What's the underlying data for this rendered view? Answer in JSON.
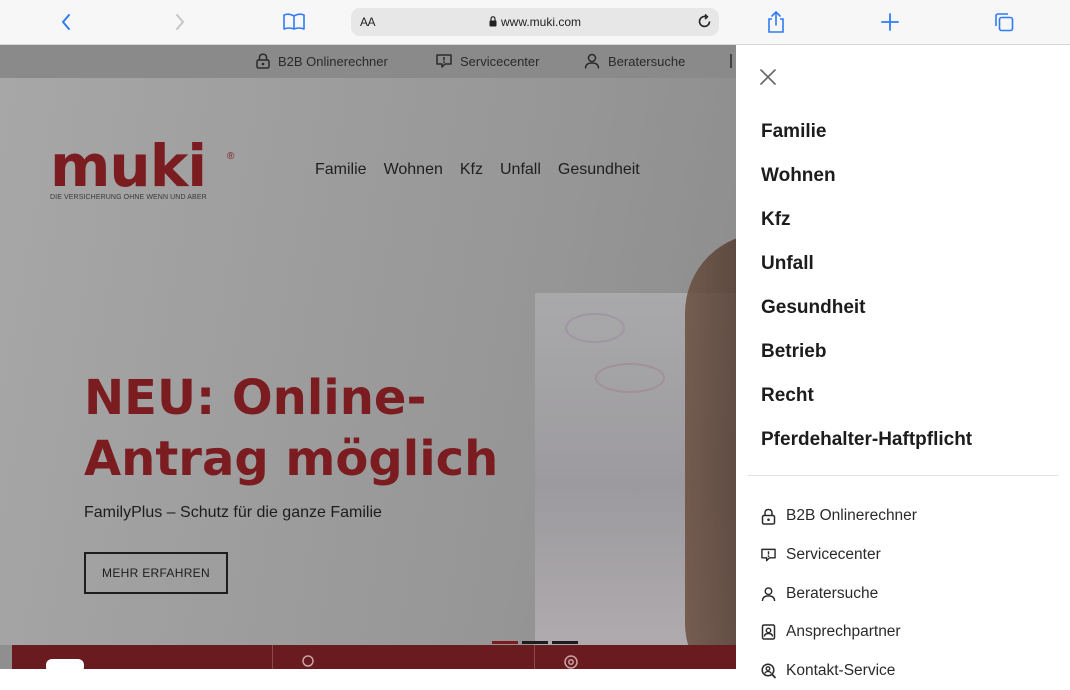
{
  "browser": {
    "text_size_label": "AA",
    "url": "www.muki.com"
  },
  "utility_nav": [
    {
      "label": "B2B Onlinerechner",
      "icon": "lock-icon"
    },
    {
      "label": "Servicecenter",
      "icon": "chat-alert-icon"
    },
    {
      "label": "Beratersuche",
      "icon": "person-icon"
    }
  ],
  "brand": {
    "name": "muki",
    "trademark": "®",
    "tagline": "DIE VERSICHERUNG OHNE WENN UND ABER",
    "color": "#7b1c20"
  },
  "main_nav": [
    "Familie",
    "Wohnen",
    "Kfz",
    "Unfall",
    "Gesundheit"
  ],
  "hero": {
    "headline_line1": "NEU: Online-",
    "headline_line2": "Antrag möglich",
    "subline": "FamilyPlus – Schutz für die ganze Familie",
    "cta_label": "MEHR ERFAHREN",
    "slide_count": 3,
    "active_slide": 1
  },
  "side_menu": {
    "primary_items": [
      "Familie",
      "Wohnen",
      "Kfz",
      "Unfall",
      "Gesundheit",
      "Betrieb",
      "Recht",
      "Pferdehalter-Haftpflicht"
    ],
    "secondary_items": [
      {
        "label": "B2B Onlinerechner",
        "icon": "lock-icon"
      },
      {
        "label": "Servicecenter",
        "icon": "chat-alert-icon"
      },
      {
        "label": "Beratersuche",
        "icon": "person-icon"
      },
      {
        "label": "Ansprechpartner",
        "icon": "contact-card-icon"
      },
      {
        "label": "Kontakt-Service",
        "icon": "search-person-icon"
      }
    ]
  }
}
